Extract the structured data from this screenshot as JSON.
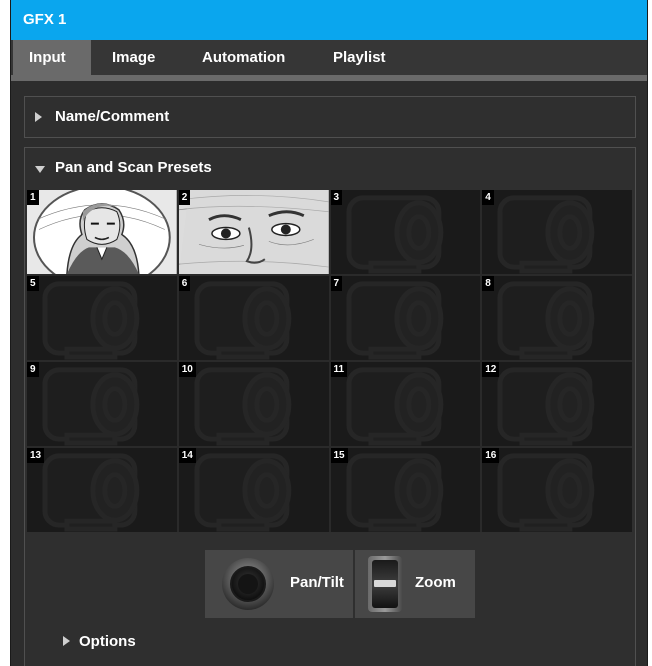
{
  "window": {
    "title": "GFX 1"
  },
  "tabs": [
    {
      "label": "Input",
      "active": true
    },
    {
      "label": "Image",
      "active": false
    },
    {
      "label": "Automation",
      "active": false
    },
    {
      "label": "Playlist",
      "active": false
    }
  ],
  "sections": {
    "name_comment": {
      "label": "Name/Comment",
      "expanded": false
    },
    "pan_scan": {
      "label": "Pan and Scan Presets",
      "expanded": true
    },
    "options": {
      "label": "Options",
      "expanded": false
    }
  },
  "presets": [
    {
      "number": "1",
      "thumbnail": "washington-full-portrait"
    },
    {
      "number": "2",
      "thumbnail": "washington-eyes-closeup"
    },
    {
      "number": "3",
      "thumbnail": "camera-placeholder"
    },
    {
      "number": "4",
      "thumbnail": "camera-placeholder"
    },
    {
      "number": "5",
      "thumbnail": "camera-placeholder"
    },
    {
      "number": "6",
      "thumbnail": "camera-placeholder"
    },
    {
      "number": "7",
      "thumbnail": "camera-placeholder"
    },
    {
      "number": "8",
      "thumbnail": "camera-placeholder"
    },
    {
      "number": "9",
      "thumbnail": "camera-placeholder"
    },
    {
      "number": "10",
      "thumbnail": "camera-placeholder"
    },
    {
      "number": "11",
      "thumbnail": "camera-placeholder"
    },
    {
      "number": "12",
      "thumbnail": "camera-placeholder"
    },
    {
      "number": "13",
      "thumbnail": "camera-placeholder"
    },
    {
      "number": "14",
      "thumbnail": "camera-placeholder"
    },
    {
      "number": "15",
      "thumbnail": "camera-placeholder"
    },
    {
      "number": "16",
      "thumbnail": "camera-placeholder"
    }
  ],
  "controls": {
    "pan_tilt": {
      "label": "Pan/Tilt",
      "icon": "joystick-icon"
    },
    "zoom": {
      "label": "Zoom",
      "icon": "zoom-rocker-icon"
    }
  },
  "colors": {
    "titlebar": "#0aa6ee",
    "active_tab": "#6a6a6a",
    "panel": "#2f2f2f"
  }
}
